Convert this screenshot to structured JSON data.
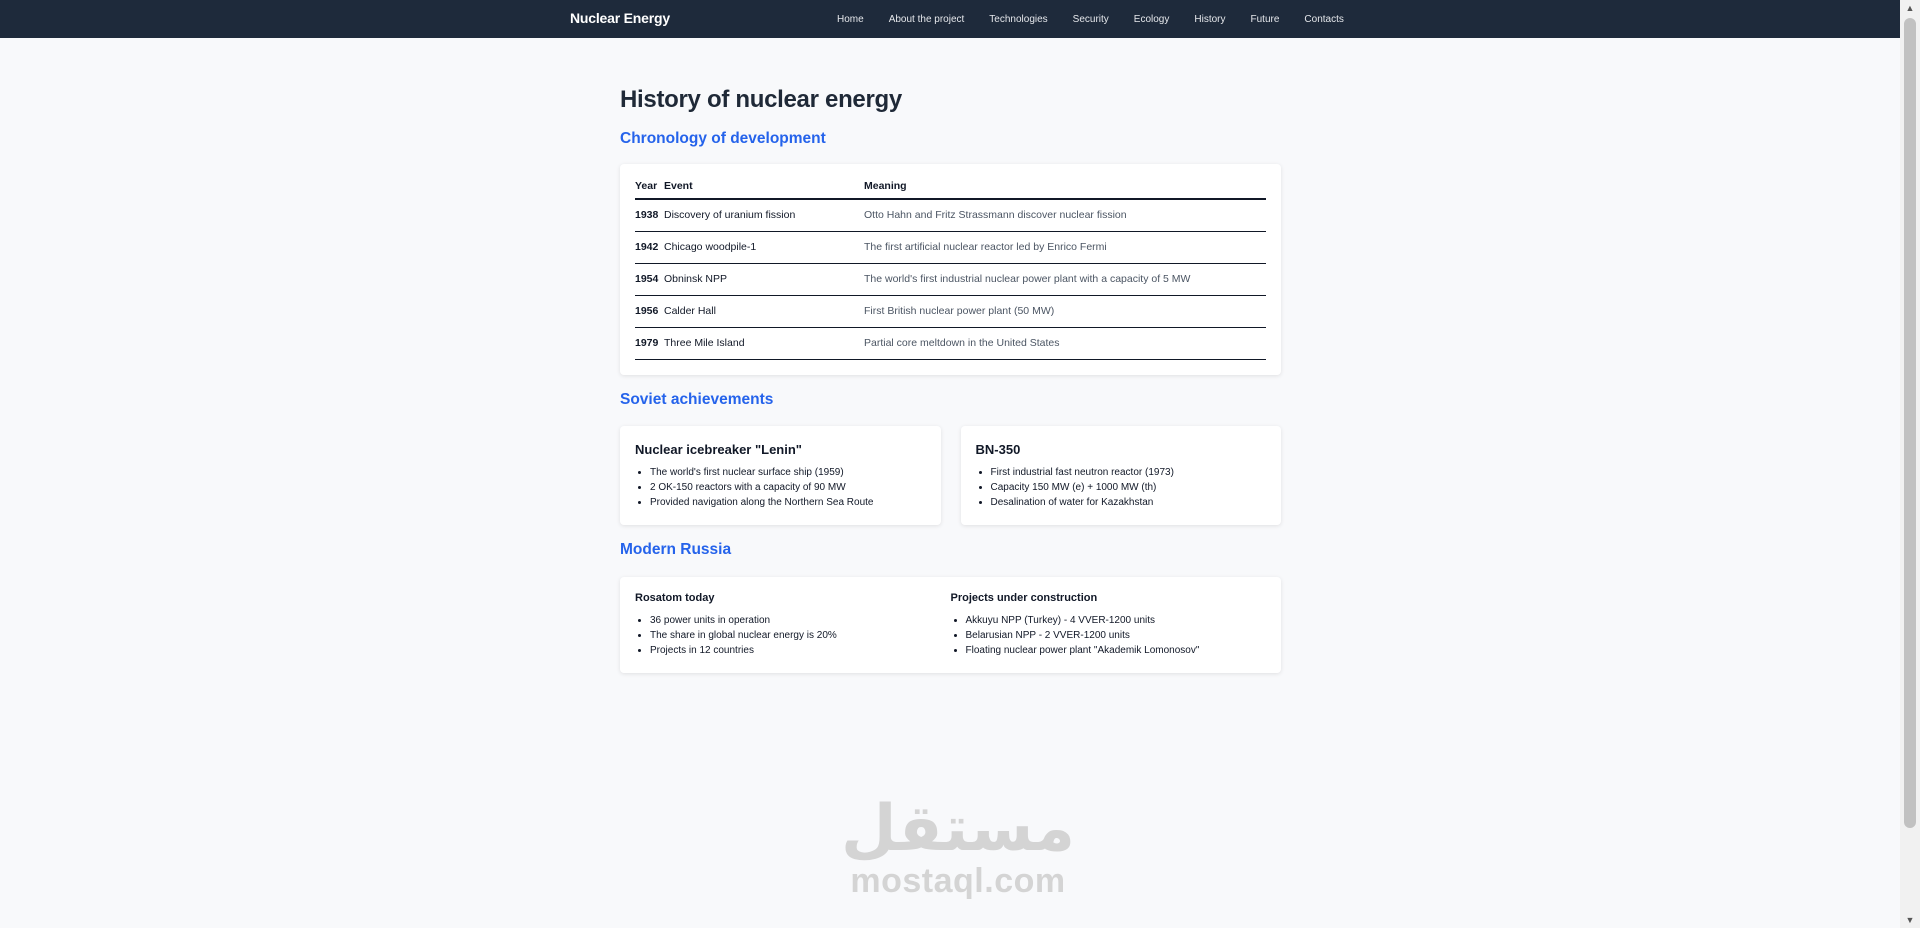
{
  "header": {
    "brand": "Nuclear Energy",
    "nav": [
      "Home",
      "About the project",
      "Technologies",
      "Security",
      "Ecology",
      "History",
      "Future",
      "Contacts"
    ]
  },
  "page": {
    "title": "History of nuclear energy"
  },
  "chronology": {
    "title": "Chronology of development",
    "columns": {
      "year": "Year",
      "event": "Event",
      "meaning": "Meaning"
    },
    "rows": [
      {
        "year": "1938",
        "event": "Discovery of uranium fission",
        "meaning": "Otto Hahn and Fritz Strassmann discover nuclear fission"
      },
      {
        "year": "1942",
        "event": "Chicago woodpile-1",
        "meaning": "The first artificial nuclear reactor led by Enrico Fermi"
      },
      {
        "year": "1954",
        "event": "Obninsk NPP",
        "meaning": "The world's first industrial nuclear power plant with a capacity of 5 MW"
      },
      {
        "year": "1956",
        "event": "Calder Hall",
        "meaning": "First British nuclear power plant (50 MW)"
      },
      {
        "year": "1979",
        "event": "Three Mile Island",
        "meaning": "Partial core meltdown in the United States"
      }
    ]
  },
  "soviet": {
    "title": "Soviet achievements",
    "cards": [
      {
        "title": "Nuclear icebreaker \"Lenin\"",
        "items": [
          "The world's first nuclear surface ship (1959)",
          "2 OK-150 reactors with a capacity of 90 MW",
          "Provided navigation along the Northern Sea Route"
        ]
      },
      {
        "title": "BN-350",
        "items": [
          "First industrial fast neutron reactor (1973)",
          "Capacity 150 MW (e) + 1000 MW (th)",
          "Desalination of water for Kazakhstan"
        ]
      }
    ]
  },
  "modern": {
    "title": "Modern Russia",
    "columns": [
      {
        "title": "Rosatom today",
        "items": [
          "36 power units in operation",
          "The share in global nuclear energy is 20%",
          "Projects in 12 countries"
        ]
      },
      {
        "title": "Projects under construction",
        "items": [
          "Akkuyu NPP (Turkey) - 4 VVER-1200 units",
          "Belarusian NPP - 2 VVER-1200 units",
          "Floating nuclear power plant \"Akademik Lomonosov\""
        ]
      }
    ]
  },
  "watermark": {
    "arabic": "مستقل",
    "latin": "mostaql.com"
  },
  "scrollbar": {
    "up_icon": "▲",
    "down_icon": "▼"
  }
}
